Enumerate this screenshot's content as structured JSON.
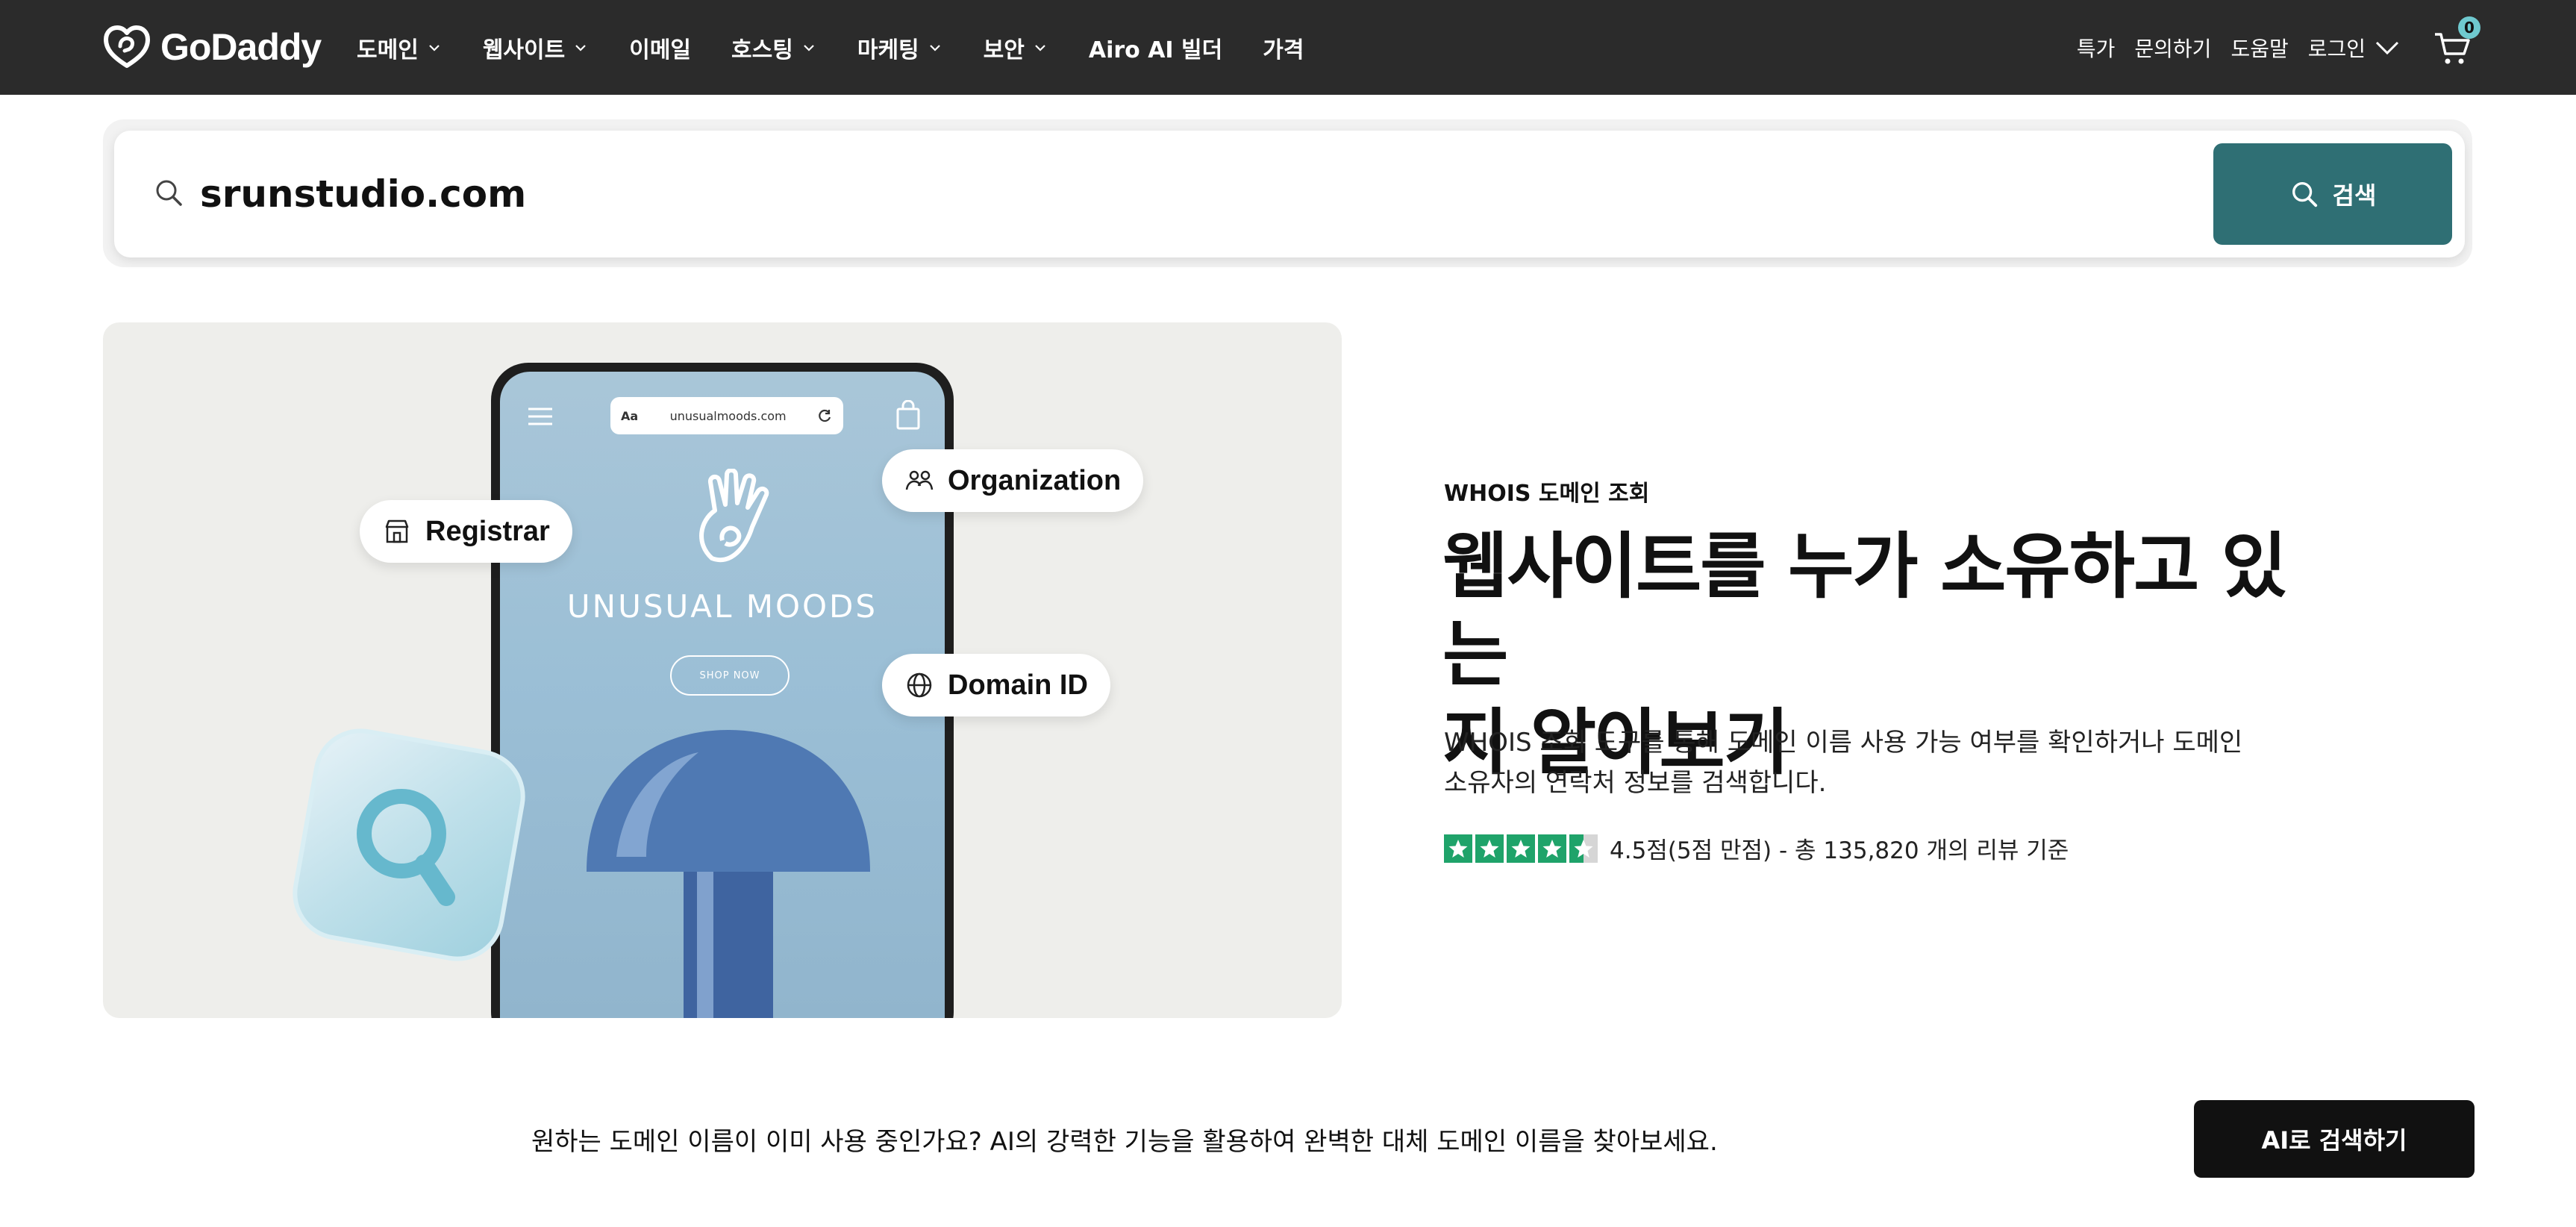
{
  "header": {
    "logo_text": "GoDaddy",
    "nav_items": [
      {
        "label": "도메인",
        "has_dropdown": true
      },
      {
        "label": "웹사이트",
        "has_dropdown": true
      },
      {
        "label": "이메일",
        "has_dropdown": false
      },
      {
        "label": "호스팅",
        "has_dropdown": true
      },
      {
        "label": "마케팅",
        "has_dropdown": true
      },
      {
        "label": "보안",
        "has_dropdown": true
      },
      {
        "label": "Airo AI 빌더",
        "has_dropdown": false
      },
      {
        "label": "가격",
        "has_dropdown": false
      }
    ],
    "right_items": {
      "deals": "특가",
      "contact": "문의하기",
      "help": "도움말",
      "login": "로그인"
    },
    "cart_count": "0"
  },
  "search": {
    "value": "srunstudio.com",
    "button_label": "검색"
  },
  "hero": {
    "image": {
      "url_text": "unusualmoods.com",
      "url_aa": "Aa",
      "brand_name": "UNUSUAL MOODS",
      "shop_now": "SHOP NOW",
      "pill_registrar": "Registrar",
      "pill_organization": "Organization",
      "pill_domain_id": "Domain ID"
    },
    "eyebrow": "WHOIS 도메인 조회",
    "headline_line1": "웹사이트를 누가 소유하고 있는",
    "headline_line2": "지 알아보기",
    "description_line1": "WHOIS 조회 도구를 통해 도메인 이름 사용 가능 여부를 확인하거나 도메인",
    "description_line2": "소유자의 연락처 정보를 검색합니다.",
    "rating": {
      "stars": 4.5,
      "text": "4.5점(5점 만점) - 총 135,820 개의 리뷰 기준"
    }
  },
  "banner": {
    "text": "원하는 도메인 이름이 이미 사용 중인가요? AI의 강력한 기능을 활용하여 완벽한 대체 도메인 이름을 찾아보세요.",
    "button_label": "AI로 검색하기"
  },
  "colors": {
    "nav_bg": "#2b2b2b",
    "search_button": "#2f6f74",
    "cart_badge": "#6fc9cf",
    "trustpilot_green": "#1fa36a",
    "banner_button": "#111111"
  }
}
